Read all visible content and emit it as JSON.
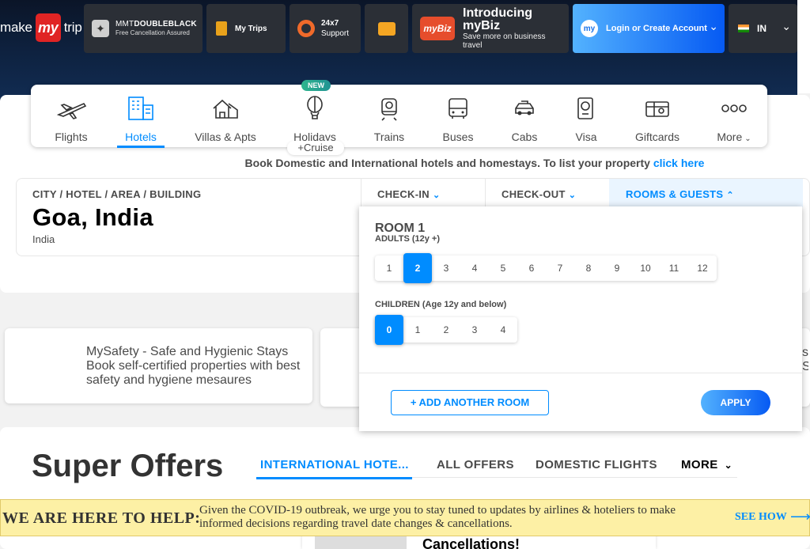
{
  "header": {
    "logo": {
      "pre": "make",
      "mid": "my",
      "post": "trip"
    },
    "doubleblack": {
      "line1_pre": "MMT",
      "line1_bold": "DOUBLEBLACK",
      "line2": "Free Cancellation Assured"
    },
    "my_trips": "My Trips",
    "support": {
      "line1": "24x7",
      "line2": "Support"
    },
    "mybiz": {
      "badge": "myBiz",
      "title": "Introducing myBiz",
      "sub": "Save more on business travel"
    },
    "login": {
      "avatar": "my",
      "label": "Login or Create Account"
    },
    "country": {
      "code": "IN"
    }
  },
  "nav": {
    "new_badge": "NEW",
    "cruise": "+Cruise",
    "items": [
      {
        "label": "Flights",
        "icon": "flight-icon"
      },
      {
        "label": "Hotels",
        "icon": "hotel-icon"
      },
      {
        "label": "Villas & Apts",
        "icon": "villa-icon"
      },
      {
        "label": "Holidays",
        "icon": "balloon-icon"
      },
      {
        "label": "Trains",
        "icon": "train-icon"
      },
      {
        "label": "Buses",
        "icon": "bus-icon"
      },
      {
        "label": "Cabs",
        "icon": "cab-icon"
      },
      {
        "label": "Visa",
        "icon": "passport-icon"
      },
      {
        "label": "Giftcards",
        "icon": "giftcard-icon"
      },
      {
        "label": "More",
        "icon": "more-icon"
      }
    ]
  },
  "tagline": {
    "text": "Book Domestic and International hotels and homestays. To list your property ",
    "link": "click here"
  },
  "search": {
    "city_label": "CITY / HOTEL / AREA / BUILDING",
    "city_value": "Goa, India",
    "city_sub": "India",
    "checkin_label": "CHECK-IN",
    "checkout_label": "CHECK-OUT",
    "rooms_label": "ROOMS & GUESTS"
  },
  "rooms": {
    "title": "ROOM 1",
    "adults_label": "ADULTS (12y +)",
    "adults": [
      "1",
      "2",
      "3",
      "4",
      "5",
      "6",
      "7",
      "8",
      "9",
      "10",
      "11",
      "12"
    ],
    "adults_selected": "2",
    "children_label": "CHILDREN (Age 12y and below)",
    "children": [
      "0",
      "1",
      "2",
      "3",
      "4"
    ],
    "children_selected": "0",
    "add_room": "+ ADD ANOTHER ROOM",
    "apply": "APPLY"
  },
  "promos": {
    "card1": "MySafety - Safe and Hygienic Stays Book self-certified properties with best safety and hygiene mesaures",
    "card2_fragment": "s S"
  },
  "offers": {
    "title": "Super Offers",
    "tabs": [
      "INTERNATIONAL HOTE...",
      "ALL OFFERS",
      "DOMESTIC FLIGHTS",
      "MORE"
    ],
    "peek_title": "Cancellations!"
  },
  "covid": {
    "head": "WE ARE HERE TO HELP:",
    "message": "Given the COVID-19 outbreak, we urge you to stay tuned to updates by airlines & hoteliers to make informed decisions regarding travel date changes & cancellations.",
    "cta": "SEE HOW"
  },
  "colors": {
    "accent": "#008cff",
    "banner": "#fdf0a5",
    "header": "#0e2240"
  }
}
